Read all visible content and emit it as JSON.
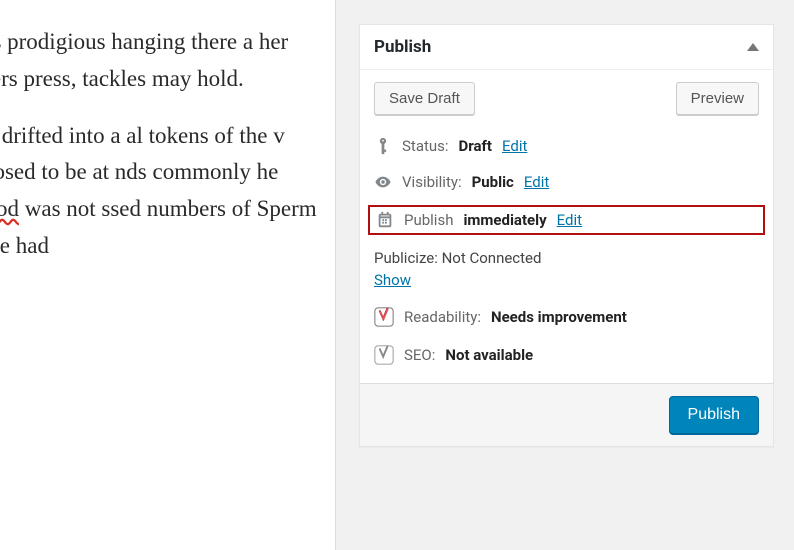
{
  "editor": {
    "para1": "hale's prodigious hanging there a her matters press, tackles may hold.",
    "para2_a": "ually drifted into a al tokens of the v supposed to be at nds commonly he ",
    "para2_pequod": "Pequod",
    "para2_b": " was not ssed numbers of Sperm Whale had"
  },
  "publish": {
    "panel_title": "Publish",
    "save_draft": "Save Draft",
    "preview": "Preview",
    "status_label": "Status:",
    "status_value": "Draft",
    "status_edit": "Edit",
    "visibility_label": "Visibility:",
    "visibility_value": "Public",
    "visibility_edit": "Edit",
    "schedule_label": "Publish",
    "schedule_value": "immediately",
    "schedule_edit": "Edit",
    "publicize_label": "Publicize: Not Connected",
    "publicize_show": "Show",
    "readability_label": "Readability:",
    "readability_value": "Needs improvement",
    "seo_label": "SEO:",
    "seo_value": "Not available",
    "publish_button": "Publish"
  }
}
